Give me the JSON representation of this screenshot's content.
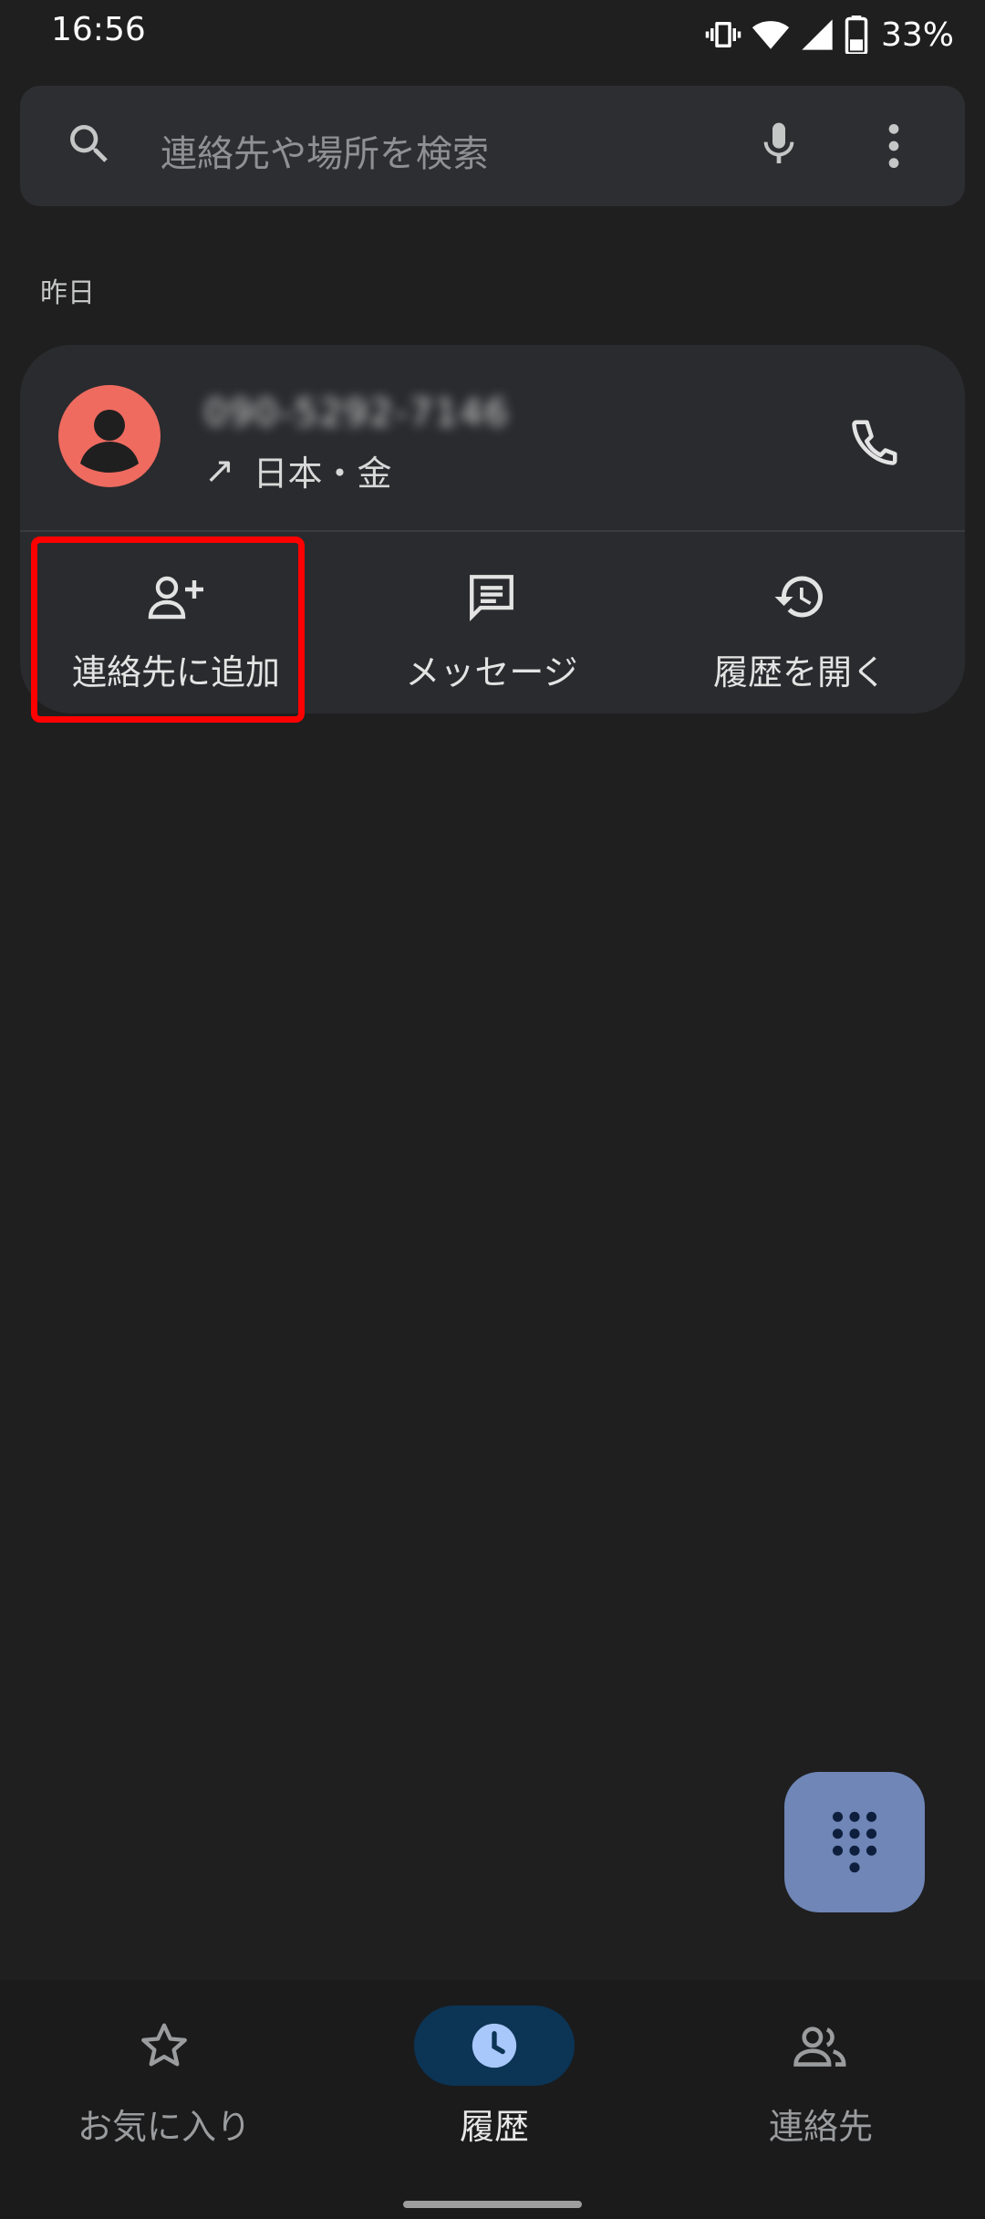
{
  "status_bar": {
    "time": "16:56",
    "battery_percent": "33%"
  },
  "search": {
    "placeholder": "連絡先や場所を検索"
  },
  "history": {
    "section_label": "昨日",
    "entries": [
      {
        "number": "090-5292-7146",
        "direction_icon": "↗",
        "location": "日本",
        "day": "金",
        "separator": "・"
      }
    ]
  },
  "actions": {
    "add_contact": "連絡先に追加",
    "message": "メッセージ",
    "open_history": "履歴を開く"
  },
  "bottom_nav": {
    "favorites": "お気に入り",
    "history": "履歴",
    "contacts": "連絡先"
  },
  "colors": {
    "background": "#1f1f1f",
    "card": "#2a2b2e",
    "avatar": "#ef6b60",
    "fab": "#6f86b7",
    "nav_active": "#0b3455",
    "highlight": "#ff0000"
  },
  "icons": {
    "search": "search-icon",
    "mic": "mic-icon",
    "more": "more-vert-icon",
    "phone": "phone-icon",
    "add_person": "person-add-icon",
    "message": "message-icon",
    "history": "history-icon",
    "dialpad": "dialpad-icon",
    "star": "star-icon",
    "clock": "clock-icon",
    "people": "people-icon"
  }
}
